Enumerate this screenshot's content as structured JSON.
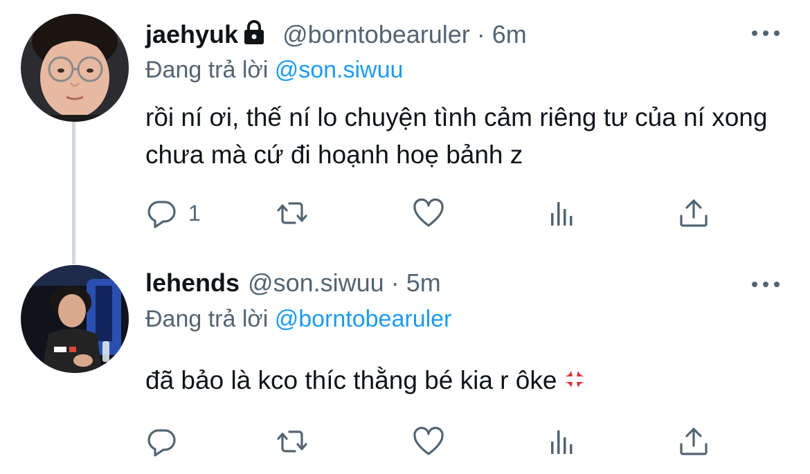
{
  "tweets": [
    {
      "display_name": "jaehyuk",
      "protected": true,
      "handle": "@borntobearuler",
      "separator": "·",
      "time": "6m",
      "replying_prefix": "Đang trả lời",
      "replying_to": "@son.siwuu",
      "text": "rồi ní ơi, thế ní lo chuyện tình cảm riêng tư của ní xong chưa mà cứ đi hoạnh hoẹ bảnh z",
      "reply_count": "1",
      "icons": [
        "reply-icon",
        "retweet-icon",
        "like-icon",
        "views-icon",
        "share-icon"
      ]
    },
    {
      "display_name": "lehends",
      "protected": false,
      "handle": "@son.siwuu",
      "separator": "·",
      "time": "5m",
      "replying_prefix": "Đang trả lời",
      "replying_to": "@borntobearuler",
      "text": "đã bảo là kco thíc thằng bé kia r ôke",
      "emoji": "anger-symbol",
      "reply_count": "",
      "icons": [
        "reply-icon",
        "retweet-icon",
        "like-icon",
        "views-icon",
        "share-icon"
      ]
    }
  ],
  "colors": {
    "text": "#0f1419",
    "secondary": "#536471",
    "link": "#1d9bf0",
    "thread_line": "#cfd9de"
  }
}
